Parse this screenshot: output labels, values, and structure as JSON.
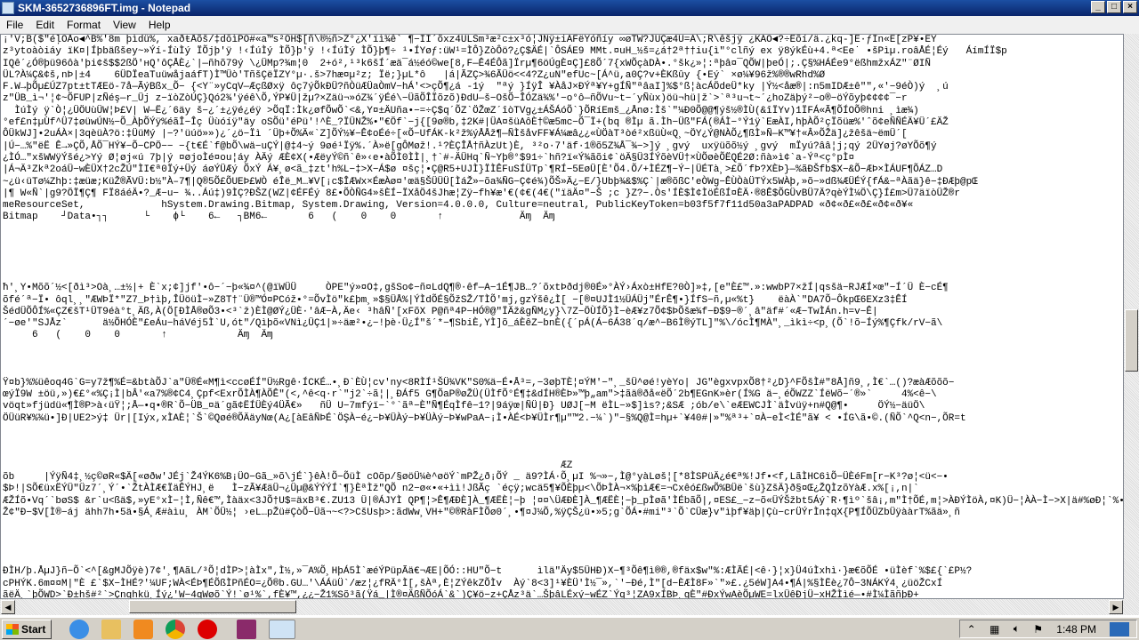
{
  "window": {
    "title": "SKM-3652736896FT.img - Notepad",
    "minimize": "_",
    "maximize": "□",
    "close": "×"
  },
  "menu": [
    "File",
    "Edit",
    "Format",
    "View",
    "Help"
  ],
  "content": "¡'V;B($\"éļÕÅo◄^B%'8m þìdü%, xaðŧÅõš/‡dŏìPÓ#«a™s²OH$[ñ\\®½ñ>Z°¿X'ïì¾ê` ¶−ÍÍ´õxz4ULSm³æ²c±x³ó¦JÑÿ±iÁFëYóñíy ∞øTW?JÜÇæ4Ü=Á\\;R\\êšjÿ ¿KÁÕ◄?÷Êõí/ä.¿kq-]Ê·ƒÍn«Ë[zP¥•ËY\nz³ytoàòiáy ïK¤|Íþbäßšey~»Ýí-ÍùÌý ÏÕjþ'ÿ !‹ÍúÌý ÌÕ}þ'ÿ !‹ÍúÌý ÌÕ}þ¶÷ ¹•ÍYøƒ:üW¹=ÌÔ}ZòÔö?¿Ç$ÄÉ|`ÔSÁE9 MMt.¤uH_½š=¿á†2ª††iu{ì\"°clñý ex ÿ8ýkÉù+4.ª<Ee˙ •šPìµ.roâÅÉ¦Éý   ÁímÍÏ$p\nIQê´¿Ó®þü96ôà'þi¢š$$2ßÖ'ʜQ'ôÇÅÈ¿`|—ñhõ79ý \\¿ÜMp?¾m¦0  2+ó²,¹³k6šÍ´æä¯á½éó©we[8,F—Ê4ÉÔã]Ïrµ¶6öÚgÈ¤Ç]£8Õ´7{xWÕçàDÀ•.°šk¿»¦:ªþâ¤¯QÕW|þeÓ|;.Ç§%HÁÉe9°ëßhmžxÁZ\"¨ØIÑ\nÜL?À¼Ç&¢š,nÞ|±4    6ÜDÏeaTuüwåjaáfT)Ì™Üò'TñšÇëÏZY°µ·.š>7hæ¤µ²z; Ïë;}µL*ô   |á|ÃZÇ>¾6ÃÜö<<4?Z¿uN\"efUc~[Á^ü,a0Ç?v+ÈKßûy {•Eý` ×ø¼¥96ž%®®wRhd%Ø\nF.W→þÕµ£ÚZ7pt±tTÆEö-7å—ÃýBßx_Õ− {<Y¨»yCqV—ÆçßØxÿ ôç7ýÕkÐÜ?ñÒüÆÜaÒmV−hÁ'<>çÕ¶¿á -1ý  \"ªý }ÍÿÎ ¥ÀåJ×ÐÝª¥Y+gÍÑ\"ªâaI]%$°ß¦àcÁÖdeÜ*ky |Ý½<åæ®|:n5mIDÆ±ê\"\",«'−9éÒ)ý  ¸ú\nz\"ÜB_ì¬'¦¢~ÕFUP|zÑéş—r_Üj z−ïòZòÚÇ}Qó2¾'ÿéê\\Õ,ÝP¥Ü|žµ?×Zäü¬»óZ¾´ÿÉé\\−ÜãÕÎÏõzõ)ÐdU—š−OšÕ−ÎÓZä¾%'−o°ô—ñÕVu~t−´yÑùx)öü¬hü|ž`>`ª³u¬t~´¿hoZäþý²−o®−öÝõyþ¢¢¢¢¯−r\n  ÌúÌý ÿ`Ò¦¿ÜÖUùÜW¦Þ£V| W—Ë¿´6äy š−¿´±¿ÿé¿éÿ >ÕqÏ:Ìk¿øfÕwÕ`<&,Y¤±ÄUña•−=÷Ç$q´ÕZ`ÖŽœZ´îòTVg¿±ÁŠÁóÕ`}ÕRíEmš_¿Ånø:Ìš`\"¼Ð0Õ@@¶ýš½®ÌÙ(&îÏYv)1ÏFÁ«Ã¶ÕÍOÕ®hni ¸ìæ¾)\n°ef£n‡µÙf^Ü7‡øüwÚN½−Õ_ÀþÕÝÿ%éãÎ−Îç Üùóíÿ\"äy oSÕü'éPü'!^È_?ÏÜNŽ%•\"€Öf`−j{[9ø®b,‡2K#|ÜA¤šüAôÈ†©æ5mc−Õ¯Ï+(bq ®Ìµ ã.Ìh−Üß\"FÁ(®ÁÌ−°Ý1ÿ`EæÀI,hþÀÕ²çÏõüæ%'ˆõ¢eÑÑÉÄ¥Ü´£ÄŽ\nÔÜkWJ]•2uÁÀ×|3qèüÀ?ö:‡ÜüMý |−?'üúö»»)¿´¿ö−Ïì ´Üþ+Õ%Ä«`Z]ÕÝ½¥−Ê¢oÉé÷[«Õ−UfÁK-k²ž%ýÅÅž¶—ÑÌšåvFF¥Á¼æâ¿¿«ÙÖàT³òé²xßüÙ«Q¸~ÖY¿Ý@NÀÕ¿¶ßÌ»Ñ—K™¥†«Â»ÕŽä]¿žêšä~ëmÜ´[\n|Ú−…%\"ëË Ê→»ÇÕ,ÅÕ¯HÝ¥−Õ−CPÖ−− −{t€É`f@bÕ\\wä−uÇÝ|@‡4~ý 9øé¹Ïÿ%.´À»ë[gÔMøž!.¹?ÈÇÎÅ†ñÀzUt)È, ³²o·7'äf·1®õ5Z¾Å¯¾−>]ý ¸gvý  uxÿüõõ½ý ¸gvý  mÏyú?ââ¦j;qý 2ÜYøj?øYÕõ¶ý\n¿ÌÓ…\"xšWWÿÝšé¿>Yý Ø¦øj«ú 7þ|ý ¤øjoÌé¤ou¦áy ÀÄý ÆÈ¢X(•ÆëyÝ©ñ`ê»‹e•àÕÌ0ÌÌ|¸†`#-ÄÜHq`Ñ~Yþ®°$91÷`hñ?ï«Ý¾ãõi¢`öÄ§Ü3ÍÝõèVÜ†×ÙÕøèÕËQÉ2Ø:ñà»ì¢`a-Ýª<ç°pÌ¤\n|Á¬Ä³Zkª2oáÜ−wÈÜX†2cŽÚ\"ÌI€ª0Ïý+Üý áøÝÜÆý ÕxÝ Á¥¸ø<ã_‡zt'h%L−‡>X−Á$ø ¤šç¦•Ç@R5+UJÌ}ÏÌÊFuSÍÜTp`¶RÍ−5EøÜ[È'Õ4.Õ/+ÌÉZ¶−Ý−|ÜÉTà¸>£Õ´fÞ?XÈÞ}—%ãÐŠfb$X−&Õ−ÆÞ×ÌÁUF¶ÕÁZ…D\n~¿ü‹üTø¼Zhþ:‡æüæ;KüŽ®ÃVÜ:b½\"À–7¶|Q®5Õ£ÕUEÞ£WÒ éÎë_M…¥V[¡c$ÎÆWx×ÉæÀø¤'œä§ŠÜÜÜ[ÌáŽ»−õa¾ÑG−Ç¢é¾)ÕŠ»Ä¿−E/}Ubþ¾&$%Ç`|æ®õßC'eÒWg−ÊÙÒàÜTÝx5WÀþ,»õ−»dß¾ÆÜÉÝ{fÁ&−ªÀãä}ê−‡ÐÆþ@pŒ\n|¶ W«Ñ`|g9?ÖÏ¶Ç¶ FÏ8áéÄ•?_Æ−u− ¾..Áú‡)9ÌÇ?ÐŠZ(WZ|¢ÉFÉý 8£•ÕÒÑG4»šÈÍ−ÏXåÖ4šJhæ¦Zÿ−fh¥æ'€(¢€(4€(\"ïäÄ¤\"−Š ;c }Z?−.Òs'ÍÈ$Ì¢ÌöÉßÍ¤ÈÄ·®8Ê$ÕGÜvBÜ7Ä?qèÝÌ¼Ö\\Ç}Í£m>Ü7äïòÜŽ®r\nmeResourceSet,             hSystem.Drawing.Bitmap, System.Drawing, Version=4.0.0.0, Culture=neutral, PublicKeyToken=b03f5f7f11d50a3aPADPAD «ð¢«ð£«ð£«ð¢«ð¥«\nBitmap    ┘Data•┐┐      └    ϕ└    6←   ┐BM6←       6   (    0    0       ↑             Äɱ  Äɱ\n\n\n\n\n\nħ'¸Y•Mõõ´½<[ðì³>Oà¸…±½|+ È`x;¢]jf'•ô−´−þ«¾¤^(@ïWÜÜ     ÒPE\"ý»¤O‡,gšSo¢−ñ¤LdQ¶®·êf—A−1É¶JB…?´õxtÞðdj®0É»°ÀÝ›Áxò±HfE?0Ò]»‡,[e\"È£™.»:wwbP7×žÍ|qsšä−RJÆÍ×œ\"−Í´Ü È−cÉ¶\nõfé´ª−Ï• ôql¸¸\"ÆWÞÏ*\"Z7_Þ†ìþ,ÎÜöüÌ−»Z8T†¨Ü®™Ó¤PCóž•°=ÕvÌö\"k£þm¸»$§ÜÅ%|ÝÌdÕÉ§ÕžSŽ/TÌÕ'mj,gzÝšê¿Ì[ −[®¤UJÌ1½ÜÁÜj\"ÉrÊ¶•}ÍfS−ñ,µ«%t}    ëàÀ`\"DA7Õ−ÔkpŒ6EXz3‡ÊÍ\nŠédÜÕÔÍ%«ÇZ€šT¹ÜT9éà°t¸Äß,À(Ö[ÐÌÅ®øÕ3•<³`ž)ÈÌ@ØÝ¿ÜÈ·'âÆ−À,Äe‹ ³hâÑ'[xFõX P@ñª4P−HÓ®@\"ÏÄž&gÑM¿y}\\7Z−ÖÙÍÕ}Ì−èÆ¥z7Õ¢$ÞÕšæ¾f−Ð$9−®´¸â\"äf#´«Æ−TwÌÁn.h=v−Ê|\n´−øe'\"SJÅz`      ä½ÕHÓÈ\"£eÁu−háVéj5Ì`U,ót\"/Qìþõ«VNì¿ÜÇ1|»÷äæ²•¿−!þè·Ü¿Í\"š´*−¶SbiÈ,YÌ]õ_áÈêZ−bnÈ({´pÁ(Á−6Á38´q/æ^−B6Ì®ýTL]\"%\\/ócÌ¶MÀ\"¸_ìkì÷<p¸(Õ`!õ−Íý%¶Çfk/rV−ã\\\n     6   (    0    0       ↑            Äɱ  Äɱ\n\n\n\nŸ¤b}%%üêoq4G`G=y7ž¶%É=&btàÕJ`a\"Ü®É«M¶ì<ccøÉÍ\"Ü½Rgê·ÍCKÉ…•¸Ð`ÈÙ¦cv'ny<8RÌÍ¹ŠÜ¾VK\"S0%ä−É•Å³=,−3øþTÈ¦¤ÝM'−\"¸_šÜ^øé!yèYo| JG\"ègxvpxÕ8†²¿D}^FÕšÌ#\"8Å]ñ9¸,Ì€`…()?æàÆõõõ−\nœýÏ9W ±öü‚»)€£°«%Ç¡Ì|bÂ'«a7%®¢C4¸Çpf<ExrÕÌÀ¶ÀÕÊ\"(<,^ê<q·r`\"j2`÷ã¦|¸ÐÁf5 G¶ÕaP®øŽÜ(ÜÌfÕ°É¶‡&dÍH®ÈÞ»™þ„am\">‡ãä®ðå«ëÕ´2b¶EGnK»èr(Í%G ä−¸éÕWZZ`ÍëWõ−´®»`     4%<ê−\\\nvöqt»fjüdü«¶Ì®P>à‹üŸ¦;Å—•q•®R`Õ−ÜB_¤ä´gã¢ËÍÜÈý4ÜÃ€»   ñÜ U−7mfýï−`°`ãª−È\"Ñ¶ÉqÌfê−1?|9áÿœ|ÑÜ|Ð} UØJ[−M ëÌL−»$]ìs?;&SÆ ;ób/e\\`eÆEWCJÌ`äÌvüÿ+n#Q@¶•     ÖÝ½−äüÖ\\\nÖÜüR¥%¾ü•]Ð|UE2>ý‡ Ür|[Iýx,xÌAÈ¦`Š`©Qøé®ÕÄäyNœ(A¿[àEâÑÞÉ`ÖŞÀ−é¿−Þ¥ÜÀý−Þ¥ÜÀý−Þ¥wPaA−¡Ì•ÀÉ<Þ¥ÜÌr¶µ\"™2.−¼`)\"−§%Q@Ì=hµ+`¥40#|»\"%ª³+`¤À−eÌ<ÌÉ\"ã¥ < •ÍG\\ã•©.(ÑÕ`^Q<n−,ÕR=t\n\n\n\n                                                                                               ÆZ\nõb     |ÝÿÑ4‡¸½ç©øR«$Ä[«øðw'JÉj`Ž4ÝK6%B¡ÜO−Gã_»õ\\jÉ`}êÀ!Õ−ÕüÌ cOõp/§øöÜ¼è^øöÝ`mPŽ¿ð¡ÕÝ _ ä9?ÌÁ·Õ¸µI %¬»−,Ì@°yàLøš¦[*8ÌSPüÄ¿é€ª%!Jf•<f,LãÌHC6ìÕ−ÜÈéFm[r−K³?ø¦<ü<−•\n$Þ!|SÕ€üxËÝÜ\"Üz7´¸Ý´•`ŽtÀÌÆ€ÏäÊÝHJ¸ë   Ì−zÃ¥ÆäÜ¬¿Üµ@&ÝÝÝÍ`¶}ÈªÌž\"QÕ n2−ø«•«+ìì!JßÃç `éçÿ;wcä5¶¥ÕÈþµ<\\ÕÞÌÀ¬×%þìÆ€=¬Cxêó£ßwÕ%BÜë`šù}ZšÄ}ð§¤Œ¿ŽQÌzõYàÆ.x%[¡,n|`\nÆŽÍõ•Vq´`bøS$ &r`u<ßä$,»yE°xÌ−¦Ì,Ñê€™,Ìàäx<3JÕ†U$=äxB³€.ZU13 Ü|®ÁJYÌ QP¶¦>Ê¶ÆÐÈ]À_¶ÆËÈ¦−þ ¦¤¤\\ÜÆÐÈ]À_¶ÆËÈ¦−þ_pÌøã'ÌÉbãÕ|,¤ES£_−z−õ«ÜÝŠžbt5Áý`R·¶ìº`šâ¡,m\"Ì†ÕÉ,m¦>ÀÐÝÌöÀ,¤K)Ü−¦ÀÀ−Ì−>X|ä#%øÐ¦`%•−Ý\nŽ¢\"Ð−$V[Ì®−áj ähh7h•5ä•§Á¸Æ#àìu¸ ÀM`ÕÜ½¦ ›eL…pŽü#ÇòÕ−Üã¬~<?>CšUsþ>:ãdWw¸VH+\"©®RàFÌÕø0´¸•¶¤J¼Õ,%ÿÇŠ¿ü•»5;g`ÕÁ•#mi\"³`Õ`CÜæ}v\"ìþf¥äþ|Çù−crÜÝrÌn‡qX{P¶ÍÕÜZbÜÿààrT%ãä»¸ñ\n\n\n\n\nÐÌH/þ.ÅµJ}ñ−Õ`<^[&gMJÕÿè)7¢'¸¶AãL/³Õ¦dÌP>¦àÌx\",Ì½,»¯A%Õ¸HþÁ5Ì`æéÝPüpÃä€¬ÆE|ÕÓ::HU\"Õ−t      ìlä\"Äy$5ÜHÐ)X−¶³Õê¶ì®®,®fäx$w\"%:ÆÌÃÉ|<ê·}¦x}Ü4úÌxhì·}æ€õÕÉ •üÌèf`%$£{`£P½?\ncPHÝK.6m¤¤M|\"È £`$X−ÌHÉ?'¼UF;WÀ<ÉÞ¶ÉÕßÌPñÉO=¿Õ®b.GU…'\\ÁÁüÜ`/æz¦¿fRÄ°Ì[,šÀª,È¦ZÝêkZÕÌv  Àý`8<3]¹¥ÈÜ'Ì½¯»,`'−Ðé,Ì\"[d−ÈÆÌ8F»`\"»£.¿5éW]A4•¶Á|%§ÌËè¿7Ô−3NÁKÝ4¸¿üöŽCxÍ\nãëÄ¸`þÕWD>`Ð±hš#²`>Çnqhkü¸Íý¿'W−4qWøõ`Ý!`ø¹%`,fÈ¥™,¿¿−Ž1%Sõ³ã(Ÿá_|Ì®¤ÄßÑÕóÁ`&`)Ç¥ö−z+ÇÅz³ä`…ŠþâLÉxý−wÉZ`Ýq³¦ZA9xÍBÞ¸gÈ\"#ÐxÝwAèÕµWE=lxÜêÐjÜ−xHŽÌìé—•#Ì¼ÌãñþÐ+\n<ÀÀ üj¾Pý`Ý+H(8°` hyøtwÉñêÜ€ÇÈèqÌ¼ùÃ=−−}ê•µÂ  .ÜäTL`>Ý¡ÝgüžfÕÈ4gz−`#Þ.J_NJH,¤ìoa−;wøp2·ÂÇ_f`¤−»æ−TyÌp«®ÉÜ¬ªP³^»ÌÈYX'−ÜC÷¸eHÌý\\<`U_ãø KÕµoÇì−½»ÆÌ}−ñÈÜ´¿Ì`ÞÕÀ−ÎTÝŠÜ−\n\n                                                                                                                   <5\n´ÉL^BII ®ÀÝòÀÈ`−/¸fÜÜaIs}ä±bk^−\"$À>ùg<•ÁúÌ¿ó]#Õ´ÌÁ#«Ö§Çne<=XÀÀ«e'P=jl·bè8JÆüê\\Àà°‡ñ,ªÂ,ÿmÌÁ†UÕ\"ž|»ÞAVS−:ê=ñÑ³_Ýì=¢£F'ÕÌ%ì®°ì3,qè>2Mi•`ä¸ø´ì−1žB−]`\"Eøn>Ì¦−RÌÕRP)a\nÌ¸`}ÕtexLÑèÌ³ÕfßŤ|−wï`Î3õ•},`f\"−sÌxÜÇ§ÕÌ°9áy¿êF«ñ†ÝÌÈ±É−³Ì¤«ÜÜ'rd\\k»,TTÉKþQIý−ÕÕJ\"ÌüùpãÈHx•†JÕ (ä<ö−&.Ž8)Ñä®p%ÜÌtÀüuäfÑM ÈúÓÌ1Ü[@ÍAçýVPÓJC,^\"¦f¹fìÈ,0£,5−ÆL<ü²",
  "scroll": {
    "vertical_fraction": 0.5,
    "horizontal_fraction": 0.0
  },
  "taskbar": {
    "start_label": "Start",
    "apps": [
      "internet-explorer-icon",
      "file-explorer-icon",
      "media-player-icon",
      "chrome-icon",
      "opera-icon",
      "winrar-icon",
      "notepad-icon"
    ],
    "clock": "1:48 PM"
  }
}
